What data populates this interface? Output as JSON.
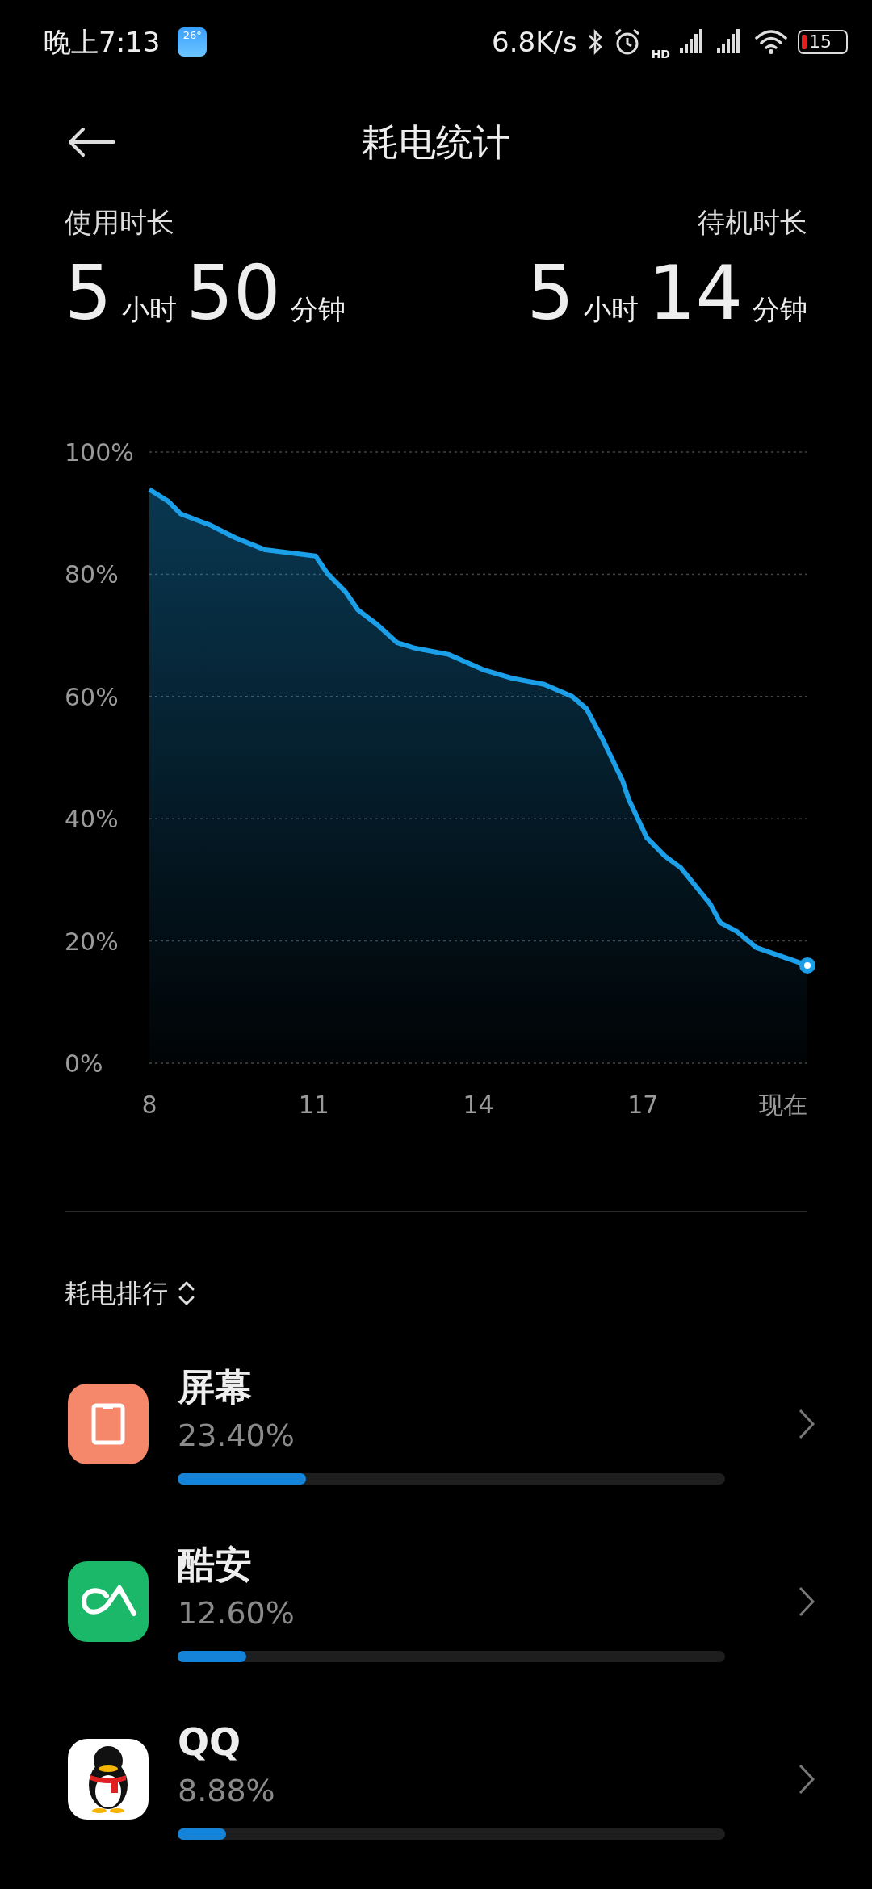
{
  "status_bar": {
    "time": "晚上7:13",
    "weather": "26°",
    "speed": "6.8K/s",
    "signal_label": "HD",
    "battery": "15"
  },
  "header": {
    "title": "耗电统计"
  },
  "usage": [
    {
      "label": "使用时长",
      "hours": "5",
      "hours_unit": "小时",
      "minutes": "50",
      "minutes_unit": "分钟"
    },
    {
      "label": "待机时长",
      "hours": "5",
      "hours_unit": "小时",
      "minutes": "14",
      "minutes_unit": "分钟"
    }
  ],
  "chart": {
    "chart_data": {
      "type": "area",
      "x": [
        8,
        8.35,
        8.57,
        9.12,
        9.56,
        10.11,
        11.03,
        11.25,
        11.58,
        11.8,
        12.15,
        12.52,
        12.85,
        13.45,
        14.11,
        14.61,
        15.2,
        15.71,
        15.97,
        16.26,
        16.63,
        16.74,
        17.07,
        17.4,
        17.69,
        18.23,
        18.41,
        18.72,
        19.07,
        20
      ],
      "grid": true,
      "series": [
        {
          "color": "#1a9fe8",
          "values": [
            93.9,
            91.9,
            89.9,
            88,
            86,
            84,
            83,
            80.1,
            77.1,
            74.2,
            71.8,
            68.8,
            67.9,
            66.9,
            64.3,
            63,
            62,
            60,
            58,
            53.1,
            46.2,
            43.2,
            36.9,
            33.9,
            32,
            26,
            23,
            21.5,
            18.9,
            16
          ]
        }
      ],
      "xlim": [
        8,
        20
      ],
      "ylim": [
        0,
        100
      ],
      "xticks": [
        8,
        11,
        14,
        17,
        {
          "value": 20,
          "label": "现在"
        }
      ],
      "yticks": [
        {
          "value": 0,
          "label": "0%"
        },
        {
          "value": 20,
          "label": "20%"
        },
        {
          "value": 40,
          "label": "40%"
        },
        {
          "value": 60,
          "label": "60%"
        },
        {
          "value": 80,
          "label": "80%"
        },
        {
          "value": 100,
          "label": "100%"
        }
      ]
    }
  },
  "ranking": {
    "title": "耗电排行",
    "items": [
      {
        "kind": "screen",
        "name": "屏幕",
        "percent": "23.40%",
        "level": 0.234
      },
      {
        "kind": "coolapk",
        "name": "酷安",
        "percent": "12.60%",
        "level": 0.126
      },
      {
        "kind": "qq",
        "name": "QQ",
        "percent": "8.88%",
        "level": 0.0888
      }
    ]
  }
}
